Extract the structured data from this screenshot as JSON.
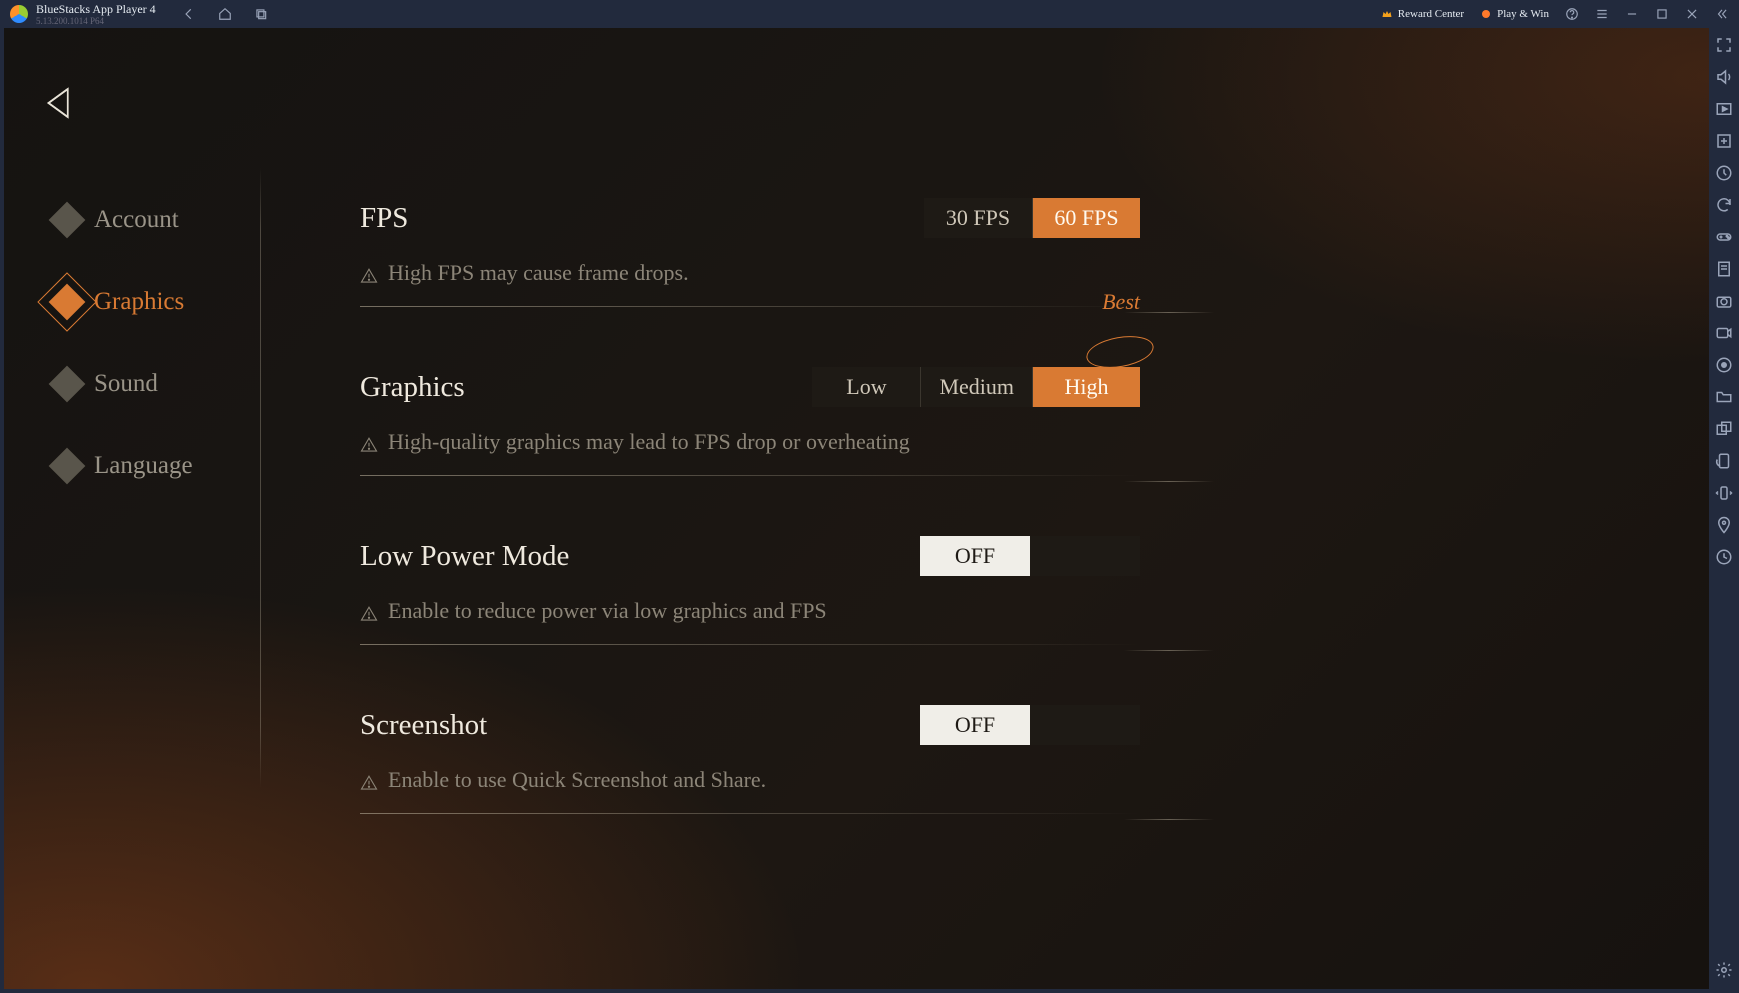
{
  "titlebar": {
    "app_name": "BlueStacks App Player 4",
    "version": "5.13.200.1014  P64",
    "reward_center": "Reward Center",
    "play_win": "Play & Win"
  },
  "nav": {
    "account": "Account",
    "graphics": "Graphics",
    "sound": "Sound",
    "language": "Language"
  },
  "settings": {
    "fps": {
      "title": "FPS",
      "opt1": "30 FPS",
      "opt2": "60 FPS",
      "hint": "High FPS may cause frame drops."
    },
    "graphics": {
      "title": "Graphics",
      "opt1": "Low",
      "opt2": "Medium",
      "opt3": "High",
      "best_tag": "Best",
      "hint": "High-quality graphics may lead to FPS drop or overheating"
    },
    "low_power": {
      "title": "Low Power Mode",
      "value": "OFF",
      "hint": "Enable to reduce power via low graphics and FPS"
    },
    "screenshot": {
      "title": "Screenshot",
      "value": "OFF",
      "hint": "Enable to use Quick Screenshot and Share."
    }
  }
}
